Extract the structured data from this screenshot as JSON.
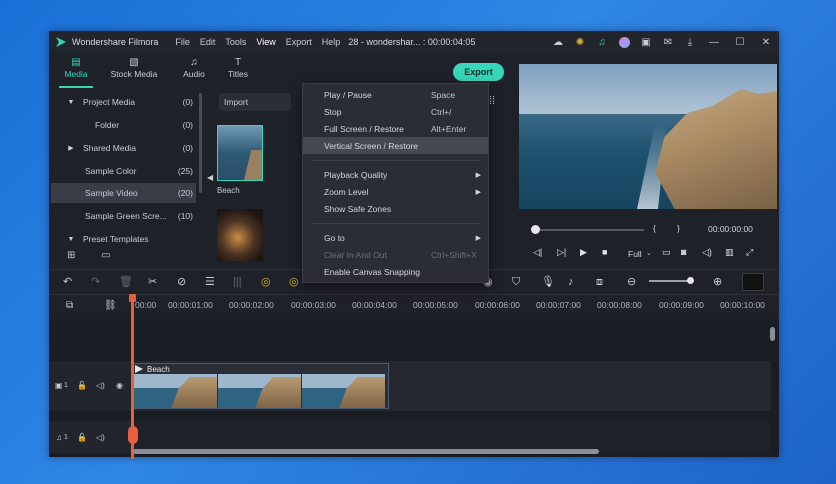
{
  "app": {
    "title": "Wondershare Filmora",
    "project_info": "28 - wondershar... : 00:00:04:05"
  },
  "menubar": [
    "File",
    "Edit",
    "Tools",
    "View",
    "Export",
    "Help"
  ],
  "tabs": [
    {
      "label": "Media",
      "icon": "media-icon"
    },
    {
      "label": "Stock Media",
      "icon": "stock-icon"
    },
    {
      "label": "Audio",
      "icon": "audio-icon"
    },
    {
      "label": "Titles",
      "icon": "titles-icon"
    }
  ],
  "export_label": "Export",
  "sidebar": [
    {
      "label": "Project Media",
      "count": "(0)",
      "arrow": "▼"
    },
    {
      "label": "Folder",
      "count": "(0)",
      "arrow": ""
    },
    {
      "label": "Shared Media",
      "count": "(0)",
      "arrow": "▶"
    },
    {
      "label": "Sample Color",
      "count": "(25)",
      "arrow": ""
    },
    {
      "label": "Sample Video",
      "count": "(20)",
      "arrow": ""
    },
    {
      "label": "Sample Green Scre...",
      "count": "(10)",
      "arrow": ""
    },
    {
      "label": "Preset Templates",
      "count": "",
      "arrow": "▼"
    }
  ],
  "media": {
    "import_label": "Import",
    "thumb1_label": "Beach"
  },
  "view_menu": [
    {
      "label": "Play / Pause",
      "shortcut": "Space"
    },
    {
      "label": "Stop",
      "shortcut": "Ctrl+/"
    },
    {
      "label": "Full Screen / Restore",
      "shortcut": "Alt+Enter"
    },
    {
      "label": "Vertical Screen / Restore",
      "shortcut": ""
    },
    {
      "label": "Playback Quality",
      "shortcut": ""
    },
    {
      "label": "Zoom Level",
      "shortcut": ""
    },
    {
      "label": "Show Safe Zones",
      "shortcut": ""
    },
    {
      "label": "Go to",
      "shortcut": ""
    },
    {
      "label": "Clear In And Out",
      "shortcut": "Ctrl+Shift+X"
    },
    {
      "label": "Enable Canvas Snapping",
      "shortcut": ""
    }
  ],
  "preview": {
    "timecode": "00:00:00:00",
    "quality": "Full",
    "brace_open": "{",
    "brace_close": "}"
  },
  "ruler": [
    "00:00",
    "00:00:01:00",
    "00:00:02:00",
    "00:00:03:00",
    "00:00:04:00",
    "00:00:05:00",
    "00:00:06:00",
    "00:00:07:00",
    "00:00:08:00",
    "00:00:09:00",
    "00:00:10:00"
  ],
  "track": {
    "clip_label": "Beach",
    "video_track_num": "1",
    "audio_track_num": "1"
  },
  "colors": {
    "accent": "#35d6b9",
    "playhead": "#e8603b",
    "highlight": "#454852"
  }
}
